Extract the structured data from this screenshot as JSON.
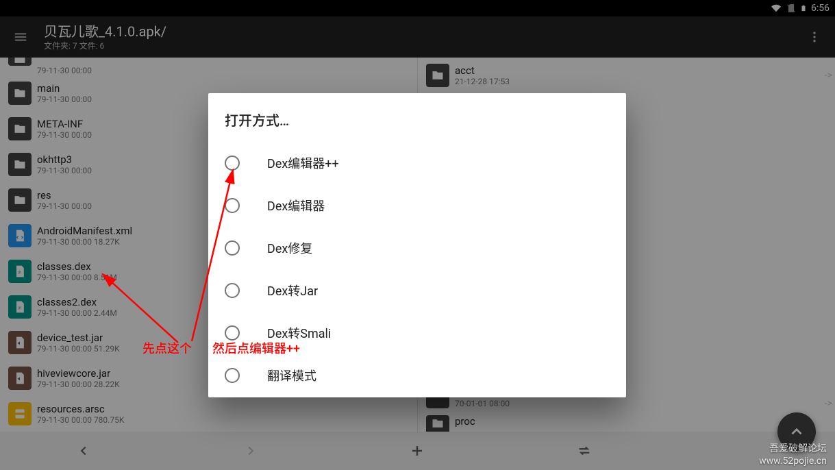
{
  "status": {
    "time": "6:56"
  },
  "appbar": {
    "title": "贝瓦儿歌_4.1.0.apk/",
    "subtitle": "文件夹: 7 文件: 6"
  },
  "left_rows": [
    {
      "kind": "partial_top",
      "meta": "79-11-30 00:00"
    },
    {
      "icon": "folder",
      "name": "main",
      "meta": "79-11-30 00:00"
    },
    {
      "icon": "folder",
      "name": "META-INF",
      "meta": "79-11-30 00:00"
    },
    {
      "icon": "folder",
      "name": "okhttp3",
      "meta": "79-11-30 00:00"
    },
    {
      "icon": "folder",
      "name": "res",
      "meta": "79-11-30 00:00"
    },
    {
      "icon": "xml",
      "name": "AndroidManifest.xml",
      "meta": "79-11-30 00:00  18.27K"
    },
    {
      "icon": "dex",
      "name": "classes.dex",
      "meta": "79-11-30 00:00  8.51M"
    },
    {
      "icon": "dex",
      "name": "classes2.dex",
      "meta": "79-11-30 00:00  2.44M"
    },
    {
      "icon": "jar",
      "name": "device_test.jar",
      "meta": "79-11-30 00:00  51.29K"
    },
    {
      "icon": "jar",
      "name": "hiveviewcore.jar",
      "meta": "79-11-30 00:00  28.22K"
    },
    {
      "icon": "arsc",
      "name": "resources.arsc",
      "meta": "79-11-30 00:00  780.75K"
    }
  ],
  "right_top": {
    "name": "acct",
    "meta": "21-12-28 17:53"
  },
  "right_bottom": [
    {
      "meta": "70-01-01 08:00"
    },
    {
      "name": "proc"
    }
  ],
  "dialog": {
    "title": "打开方式…",
    "options": [
      "Dex编辑器++",
      "Dex编辑器",
      "Dex修复",
      "Dex转Jar",
      "Dex转Smali",
      "翻译模式"
    ]
  },
  "annotation": {
    "text1": "先点这个",
    "text2": "然后点编辑器++"
  },
  "watermark": {
    "line1": "吾爱破解论坛",
    "line2": "www.52pojie.cn"
  }
}
